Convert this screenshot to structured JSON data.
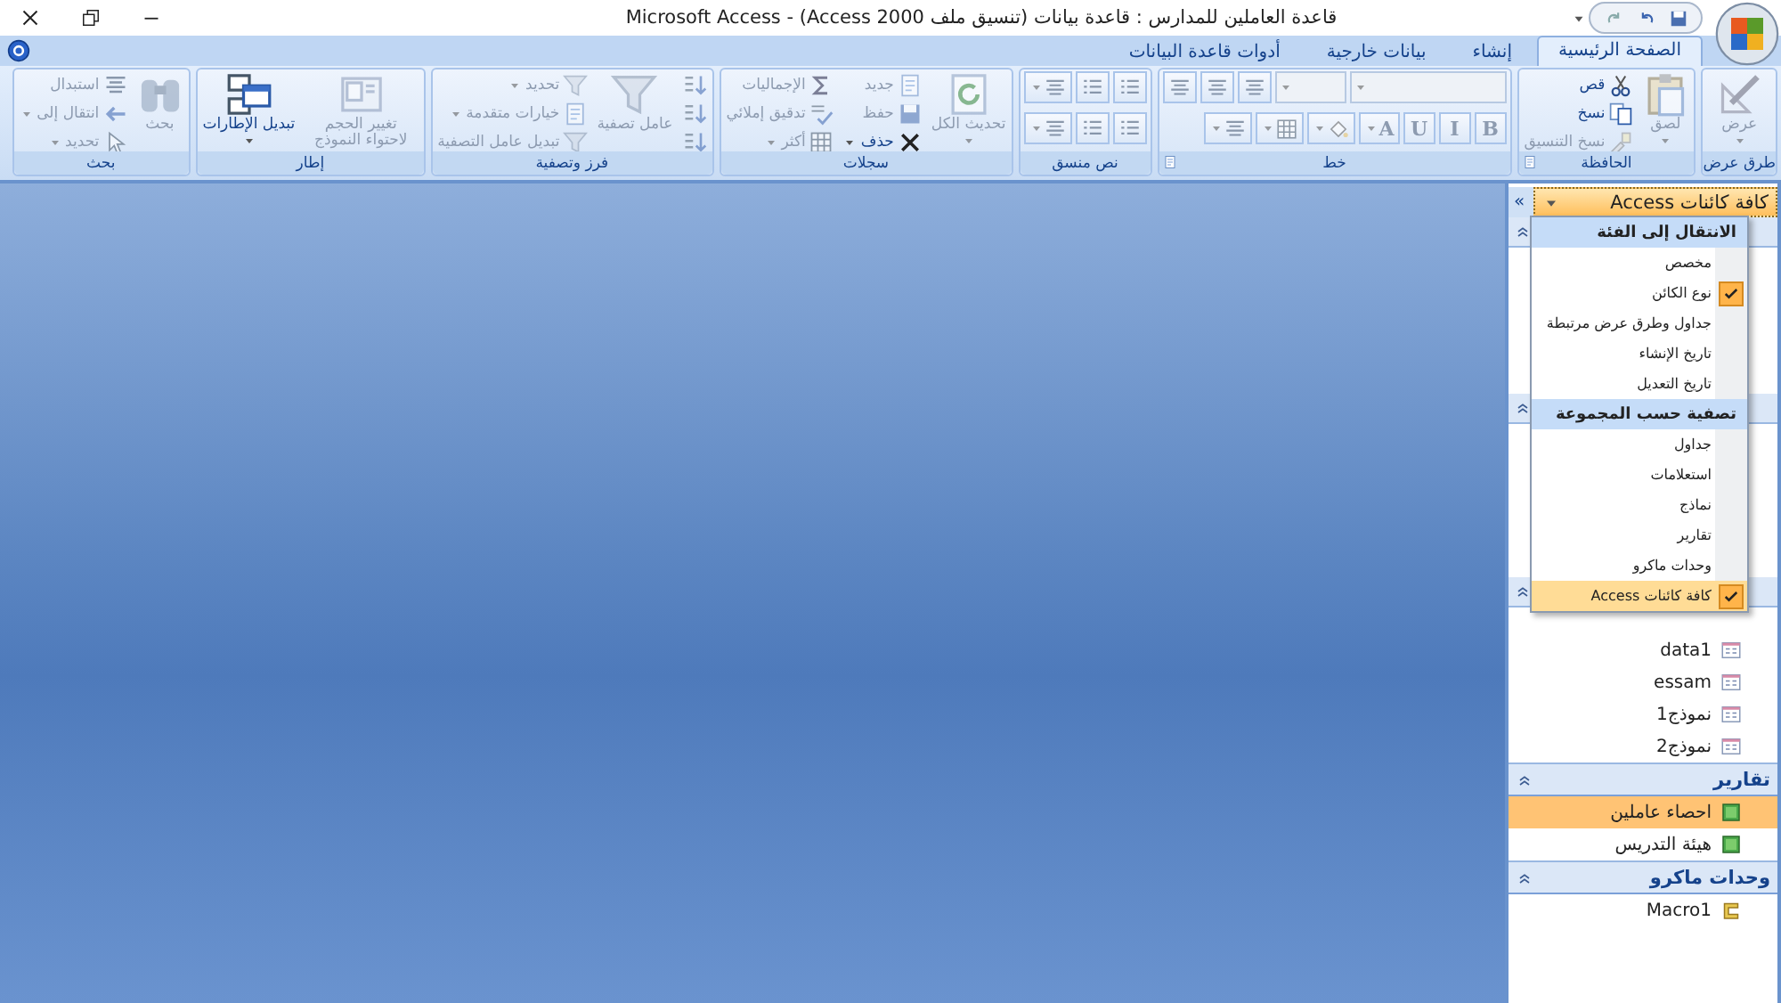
{
  "title_bar": {
    "title": "قاعدة العاملين للمدارس : قاعدة بيانات (تنسيق ملف Access 2000) - Microsoft Access"
  },
  "ribbon": {
    "tabs": [
      {
        "label": "الصفحة الرئيسية",
        "selected": true
      },
      {
        "label": "إنشاء",
        "selected": false
      },
      {
        "label": "بيانات خارجية",
        "selected": false
      },
      {
        "label": "أدوات قاعدة البيانات",
        "selected": false
      }
    ],
    "groups": [
      {
        "label": "طرق عرض",
        "launcher": false,
        "columns": [
          [
            {
              "kind": "large",
              "label": "عرض",
              "disabled": true,
              "dropdown": true
            }
          ]
        ]
      },
      {
        "label": "الحافظة",
        "launcher": true,
        "columns": [
          [
            {
              "kind": "large",
              "label": "لصق",
              "disabled": true,
              "dropdown": true
            }
          ],
          [
            {
              "kind": "small",
              "label": "قص",
              "disabled": false,
              "dropdown": false
            },
            {
              "kind": "small",
              "label": "نسخ",
              "disabled": false,
              "dropdown": false
            },
            {
              "kind": "small",
              "label": "نسخ التنسيق",
              "disabled": true,
              "dropdown": false
            }
          ]
        ]
      },
      {
        "label": "خط",
        "launcher": true,
        "columns": [
          [
            {
              "kind": "toolrow",
              "tools": [
                {
                  "kind": "combo",
                  "disabled": true
                },
                {
                  "kind": "combo",
                  "disabled": true
                },
                {
                  "kind": "icon",
                  "disabled": true,
                  "dropdown": false
                },
                {
                  "kind": "icon",
                  "disabled": true,
                  "dropdown": false
                },
                {
                  "kind": "icon",
                  "disabled": true,
                  "dropdown": false
                }
              ]
            },
            {
              "kind": "toolrow",
              "tools": [
                {
                  "kind": "letter",
                  "label": "B",
                  "disabled": true,
                  "dropdown": false
                },
                {
                  "kind": "letter",
                  "label": "I",
                  "disabled": true,
                  "dropdown": false
                },
                {
                  "kind": "letter",
                  "label": "U",
                  "disabled": true,
                  "dropdown": false
                },
                {
                  "kind": "letter",
                  "label": "A",
                  "disabled": true,
                  "dropdown": true
                },
                {
                  "kind": "icon",
                  "disabled": true,
                  "dropdown": true
                },
                {
                  "kind": "icon",
                  "disabled": true,
                  "dropdown": true
                },
                {
                  "kind": "icon",
                  "disabled": true,
                  "dropdown": true
                }
              ]
            }
          ]
        ]
      },
      {
        "label": "نص منسق",
        "launcher": false,
        "columns": [
          [
            {
              "kind": "toolrow",
              "tools": [
                {
                  "kind": "icon",
                  "disabled": true,
                  "dropdown": false
                },
                {
                  "kind": "icon",
                  "disabled": true,
                  "dropdown": false
                },
                {
                  "kind": "icon",
                  "disabled": true,
                  "dropdown": true
                }
              ]
            },
            {
              "kind": "toolrow",
              "tools": [
                {
                  "kind": "icon",
                  "disabled": true,
                  "dropdown": false
                },
                {
                  "kind": "icon",
                  "disabled": true,
                  "dropdown": false
                },
                {
                  "kind": "icon",
                  "disabled": true,
                  "dropdown": true
                }
              ]
            }
          ]
        ]
      },
      {
        "label": "سجلات",
        "launcher": false,
        "columns": [
          [
            {
              "kind": "large",
              "label": "تحديث الكل",
              "disabled": true,
              "dropdown": true
            }
          ],
          [
            {
              "kind": "small",
              "label": "جديد",
              "disabled": true,
              "dropdown": false
            },
            {
              "kind": "small",
              "label": "حفظ",
              "disabled": true,
              "dropdown": false
            },
            {
              "kind": "small",
              "label": "حذف",
              "disabled": false,
              "dropdown": true
            }
          ],
          [
            {
              "kind": "small",
              "label": "الإجماليات",
              "disabled": true,
              "dropdown": false
            },
            {
              "kind": "small",
              "label": "تدقيق إملائي",
              "disabled": true,
              "dropdown": false
            },
            {
              "kind": "small",
              "label": "أكثر",
              "disabled": true,
              "dropdown": true
            }
          ]
        ]
      },
      {
        "label": "فرز وتصفية",
        "launcher": false,
        "columns": [
          [
            {
              "kind": "icon",
              "disabled": true,
              "dropdown": false
            },
            {
              "kind": "icon",
              "disabled": true,
              "dropdown": false
            },
            {
              "kind": "icon",
              "disabled": true,
              "dropdown": false
            }
          ],
          [
            {
              "kind": "large",
              "label": "عامل تصفية",
              "disabled": true,
              "dropdown": false
            }
          ],
          [
            {
              "kind": "small",
              "label": "تحديد",
              "disabled": true,
              "dropdown": true
            },
            {
              "kind": "small",
              "label": "خيارات متقدمة",
              "disabled": true,
              "dropdown": true
            },
            {
              "kind": "small",
              "label": "تبديل عامل التصفية",
              "disabled": true,
              "dropdown": false
            }
          ]
        ]
      },
      {
        "label": "إطار",
        "launcher": false,
        "columns": [
          [
            {
              "kind": "large",
              "label": "تغيير الحجم لاحتواء النموذج",
              "disabled": true,
              "dropdown": false
            }
          ],
          [
            {
              "kind": "large",
              "label": "تبديل الإطارات",
              "disabled": false,
              "dropdown": true
            }
          ]
        ]
      },
      {
        "label": "بحث",
        "launcher": false,
        "columns": [
          [
            {
              "kind": "large",
              "label": "بحث",
              "disabled": true,
              "dropdown": false
            }
          ],
          [
            {
              "kind": "small",
              "label": "استبدال",
              "disabled": true,
              "dropdown": false
            },
            {
              "kind": "small",
              "label": "انتقال إلى",
              "disabled": true,
              "dropdown": true
            },
            {
              "kind": "small",
              "label": "تحديد",
              "disabled": true,
              "dropdown": true
            }
          ]
        ]
      }
    ]
  },
  "navigation_pane": {
    "header": "كافة كائنات Access",
    "collapse_button": "»",
    "groups": [
      {
        "items": [
          {
            "label": "data1",
            "kind": "form",
            "selected": false
          },
          {
            "label": "essam",
            "kind": "form",
            "selected": false
          },
          {
            "label": "نموذج1",
            "kind": "form",
            "selected": false
          },
          {
            "label": "نموذج2",
            "kind": "form",
            "selected": false
          }
        ]
      },
      {
        "label": "تقارير",
        "items": [
          {
            "label": "احصاء عاملين",
            "kind": "report",
            "selected": true
          },
          {
            "label": "هيئة التدريس",
            "kind": "report",
            "selected": false
          }
        ]
      },
      {
        "label": "وحدات ماكرو",
        "items": [
          {
            "label": "Macro1",
            "kind": "macro",
            "selected": false
          }
        ]
      }
    ],
    "menu": {
      "sections": [
        {
          "heading": "الانتقال إلى الفئة",
          "items": [
            {
              "label": "مخصص",
              "checked": false,
              "selected": false
            },
            {
              "label": "نوع الكائن",
              "checked": true,
              "selected": false
            },
            {
              "label": "جداول وطرق عرض مرتبطة",
              "checked": false,
              "selected": false
            },
            {
              "label": "تاريخ الإنشاء",
              "checked": false,
              "selected": false
            },
            {
              "label": "تاريخ التعديل",
              "checked": false,
              "selected": false
            }
          ]
        },
        {
          "heading": "تصفية حسب المجموعة",
          "items": [
            {
              "label": "جداول",
              "checked": false,
              "selected": false
            },
            {
              "label": "استعلامات",
              "checked": false,
              "selected": false
            },
            {
              "label": "نماذج",
              "checked": false,
              "selected": false
            },
            {
              "label": "تقارير",
              "checked": false,
              "selected": false
            },
            {
              "label": "وحدات ماكرو",
              "checked": false,
              "selected": false
            },
            {
              "label": "كافة كائنات Access",
              "checked": true,
              "selected": true
            }
          ]
        }
      ]
    }
  }
}
